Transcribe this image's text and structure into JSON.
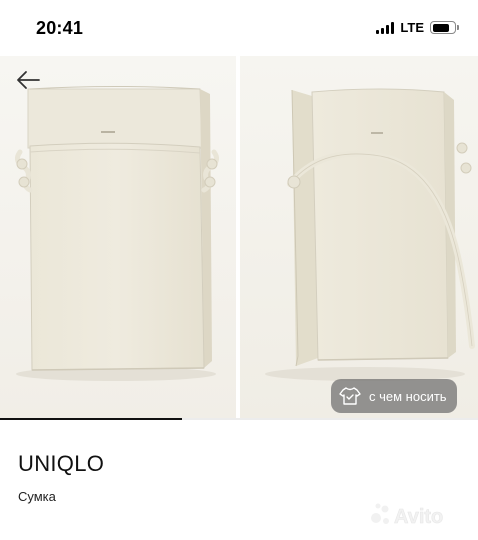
{
  "status_bar": {
    "time": "20:41",
    "network": "LTE",
    "battery_level": 0.8
  },
  "gallery": {
    "photo_count": 2,
    "background_color": "#f5f3ee",
    "bag_color": "#ece8da",
    "back_icon": "arrow-left-icon",
    "outfit_button": {
      "label": "с чем носить",
      "icon": "outfit-icon"
    },
    "progress": 0.38
  },
  "product": {
    "brand": "UNIQLO",
    "category": "Сумка"
  },
  "watermark": {
    "text": "Avito",
    "icon": "avito-logo-icon"
  }
}
